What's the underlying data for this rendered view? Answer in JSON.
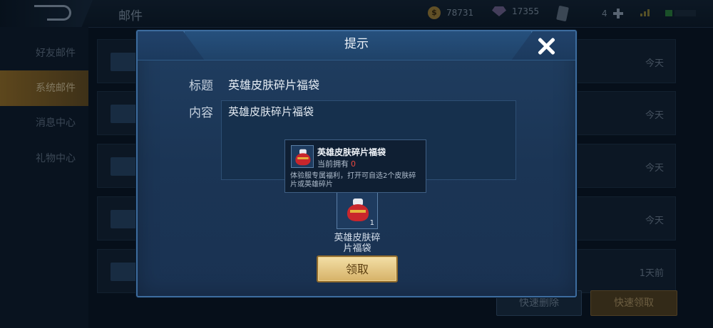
{
  "header": {
    "page_title": "邮件",
    "gold": "78731",
    "gems": "17355",
    "cards": "4"
  },
  "sidebar": {
    "items": [
      {
        "label": "好友邮件"
      },
      {
        "label": "系统邮件"
      },
      {
        "label": "消息中心"
      },
      {
        "label": "礼物中心"
      }
    ]
  },
  "mail_list": [
    {
      "time": "今天"
    },
    {
      "time": "今天"
    },
    {
      "time": "今天"
    },
    {
      "time": "今天"
    },
    {
      "time": "1天前"
    }
  ],
  "bottom_buttons": {
    "delete_label": "快速删除",
    "claim_all_label": "快速领取"
  },
  "dialog": {
    "title": "提示",
    "subject_label": "标题",
    "subject_value": "英雄皮肤碎片福袋",
    "content_label": "内容",
    "content_value": "英雄皮肤碎片福袋",
    "item": {
      "name": "英雄皮肤碎\n片福袋",
      "count": "1",
      "icon": "lucky-bag-icon"
    },
    "claim_label": "领取"
  },
  "tooltip": {
    "name": "英雄皮肤碎片福袋",
    "own_label": "当前拥有",
    "own_value": "0",
    "description": "体验服专属福利，打开可自选2个皮肤碎片或英雄碎片"
  },
  "colors": {
    "accent_gold": "#d6b268",
    "dialog_bg": "#1b3555",
    "owned_zero": "#e8483f"
  }
}
